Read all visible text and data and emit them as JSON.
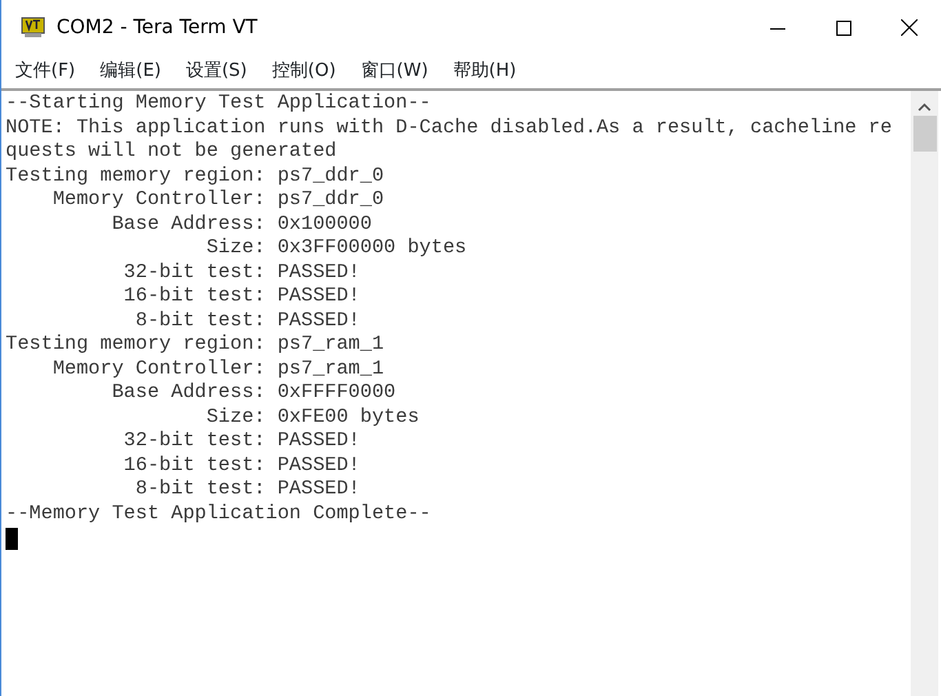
{
  "window": {
    "title": "COM2 - Tera Term VT"
  },
  "menu": [
    "文件(F)",
    "编辑(E)",
    "设置(S)",
    "控制(O)",
    "窗口(W)",
    "帮助(H)"
  ],
  "terminal": {
    "lines": [
      "--Starting Memory Test Application--",
      "NOTE: This application runs with D-Cache disabled.As a result, cacheline re",
      "quests will not be generated",
      "Testing memory region: ps7_ddr_0",
      "    Memory Controller: ps7_ddr_0",
      "         Base Address: 0x100000",
      "                 Size: 0x3FF00000 bytes",
      "          32-bit test: PASSED!",
      "          16-bit test: PASSED!",
      "           8-bit test: PASSED!",
      "Testing memory region: ps7_ram_1",
      "    Memory Controller: ps7_ram_1",
      "         Base Address: 0xFFFF0000",
      "                 Size: 0xFE00 bytes",
      "          32-bit test: PASSED!",
      "          16-bit test: PASSED!",
      "           8-bit test: PASSED!",
      "--Memory Test Application Complete--"
    ]
  }
}
